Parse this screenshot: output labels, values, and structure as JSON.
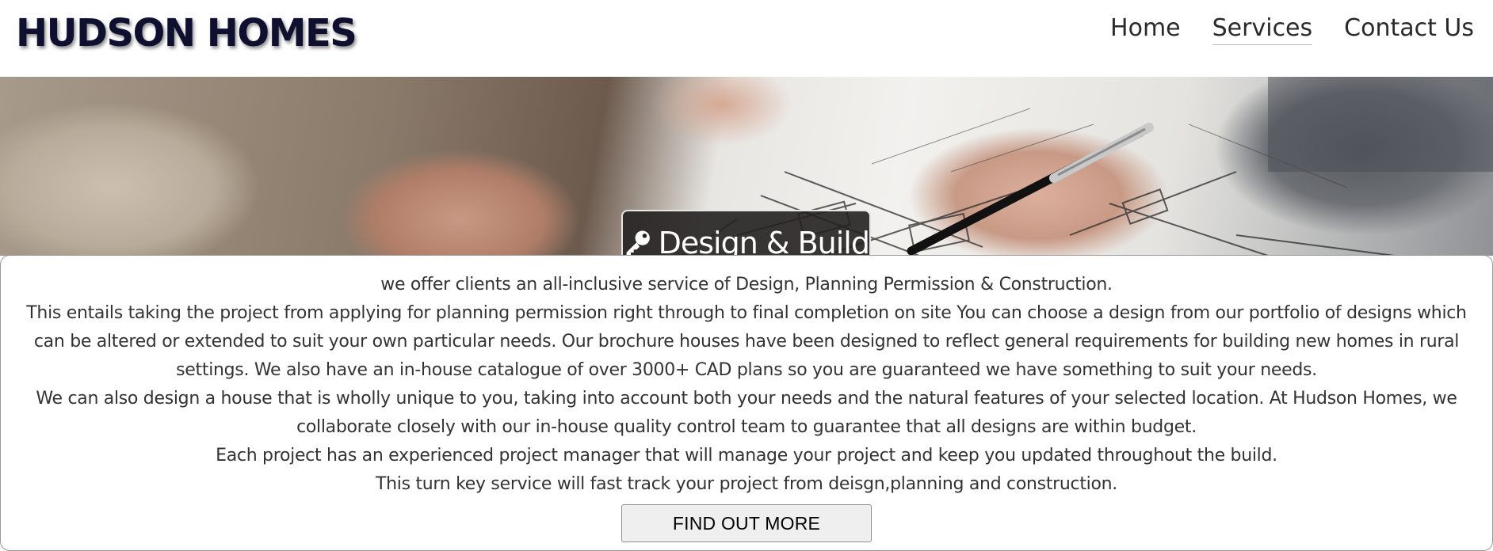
{
  "header": {
    "brand": "HUDSON HOMES",
    "nav": [
      {
        "label": "Home"
      },
      {
        "label": "Services",
        "active": true
      },
      {
        "label": "Contact Us"
      }
    ]
  },
  "hero": {
    "title": "Design & Build",
    "icon": "key-icon",
    "image": "hands-over-floor-plan-photo"
  },
  "content": {
    "paragraphs": [
      "we offer clients an all-inclusive service of Design, Planning Permission & Construction.",
      "This entails taking the project from applying for planning permission right through to final completion on site You can choose a design from our portfolio of designs which can be altered or extended to suit your own particular needs. Our brochure houses have been designed to reflect general requirements for building new homes in rural settings. We also have an in-house catalogue of over 3000+ CAD plans so you are guaranteed we have something to suit your needs.",
      "We can also design a house that is wholly unique to you, taking into account both your needs and the natural features of your selected location. At Hudson Homes, we collaborate closely with our in-house quality control team to guarantee that all designs are within budget.",
      "Each project has an experienced project manager that will manage your project and keep you updated throughout the build.",
      "This turn key service will fast track your project from deisgn,planning and construction."
    ],
    "cta_label": "FIND OUT MORE"
  },
  "colors": {
    "brand": "#0f1030",
    "text": "#333333",
    "badge_bg": "#232120"
  }
}
